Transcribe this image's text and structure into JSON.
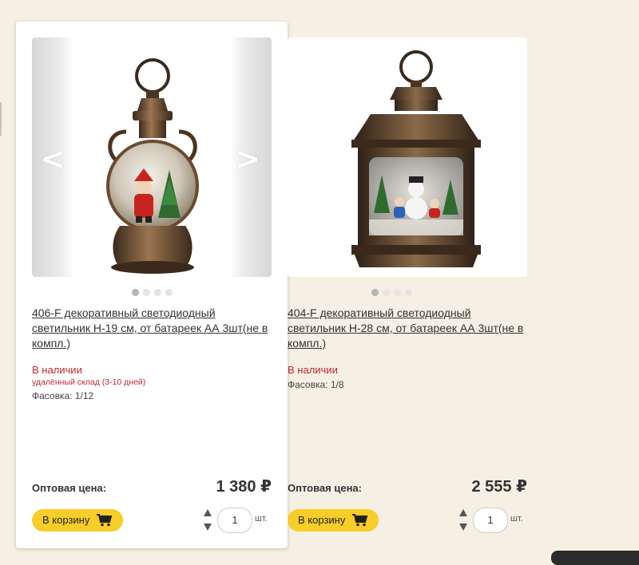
{
  "products": [
    {
      "title": "406-F декоративный светодиодный светильник H-19 см, от батареек АА 3шт(не в компл.)",
      "stock": "В наличии",
      "warehouse": "удалённый склад (3-10 дней)",
      "pack": "Фасовка: 1/12",
      "price_label": "Оптовая цена:",
      "price": "1 380 ₽",
      "cart_label": "В корзину",
      "quantity": "1",
      "unit": "шт.",
      "prev_arrow": "<",
      "next_arrow": ">",
      "image_icon": "snow-globe-lantern-icon",
      "slide_count": 4,
      "active_slide": 1
    },
    {
      "title": "404-F декоративный светодиодный светильник H-28 см, от батареек АА 3шт(не в компл.)",
      "stock": "В наличии",
      "pack": "Фасовка: 1/8",
      "price_label": "Оптовая цена:",
      "price": "2 555 ₽",
      "cart_label": "В корзину",
      "quantity": "1",
      "unit": "шт.",
      "image_icon": "square-lantern-icon",
      "slide_count": 4,
      "active_slide": 1
    }
  ],
  "colors": {
    "page_bg": "#f6efe3",
    "button": "#f7cd27",
    "stock_red": "#c0282d",
    "bronze": "#6b4a2e"
  }
}
